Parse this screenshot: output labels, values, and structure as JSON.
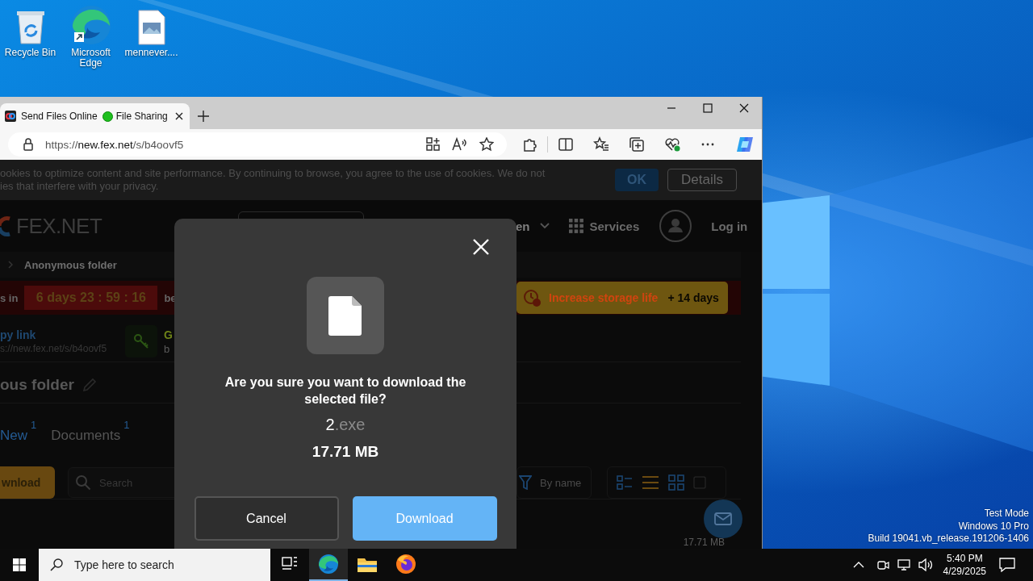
{
  "desktop": {
    "icons": [
      {
        "kind": "bin",
        "label": "Recycle Bin"
      },
      {
        "kind": "browser",
        "label": "Microsoft Edge"
      },
      {
        "kind": "image-file",
        "label": "mennever...."
      }
    ],
    "system_text": [
      "Test Mode",
      "Windows 10 Pro",
      "Build 19041.vb_release.191206-1406"
    ]
  },
  "browser": {
    "tabs": [
      {
        "title": "Send Files Online",
        "title_after_dot": "File Sharing",
        "selected": true
      }
    ],
    "address": {
      "scheme": "https://",
      "host": "new.fex.net",
      "path": "/s/b4oovf5"
    }
  },
  "page": {
    "cookie_notice": {
      "lines": [
        "ookies to optimize content and site performance. By continuing to browse, you agree to the use of cookies. We do not",
        "ies that interfere with your privacy."
      ],
      "ok": "OK",
      "details": "Details"
    },
    "header": {
      "logo": "FEX.NET",
      "language": "en",
      "services": "Services",
      "login": "Log in"
    },
    "breadcrumb": "Anonymous folder",
    "expiry": {
      "prefix": "s in",
      "countdown": "6 days 23 : 59 : 16",
      "suffix": "be",
      "upsell": "Increase storage life",
      "bonus": "+ 14 days"
    },
    "share": {
      "link_label": "py link",
      "link_url": "s://new.fex.net/s/b4oovf5",
      "code_label": "G",
      "code_value": "b"
    },
    "folder_title": "ous folder",
    "tabs": [
      {
        "label": "New",
        "count": "1",
        "selected": true
      },
      {
        "label": "Documents",
        "count": "1",
        "selected": false
      }
    ],
    "toolbar": {
      "download": "wnload",
      "search_placeholder": "Search",
      "sort": "By name",
      "views": [
        {
          "kind": "detail",
          "selected": false
        },
        {
          "kind": "list",
          "selected": true
        },
        {
          "kind": "grid",
          "selected": false
        }
      ],
      "select_all": {
        "checked": false
      }
    },
    "files": [
      {
        "size": "17.71 MB"
      }
    ]
  },
  "dialog": {
    "question": "Are you sure you want to download the selected file?",
    "file_name": "2",
    "file_ext": ".exe",
    "file_size": "17.71 MB",
    "cancel": "Cancel",
    "confirm": "Download"
  },
  "taskbar": {
    "search_placeholder": "Type here to search",
    "apps": [
      {
        "kind": "task-view",
        "selected": false
      },
      {
        "kind": "edge",
        "selected": true
      },
      {
        "kind": "explorer",
        "selected": false
      },
      {
        "kind": "firefox",
        "selected": false
      }
    ],
    "time": "5:40 PM",
    "date": "4/29/2025"
  }
}
